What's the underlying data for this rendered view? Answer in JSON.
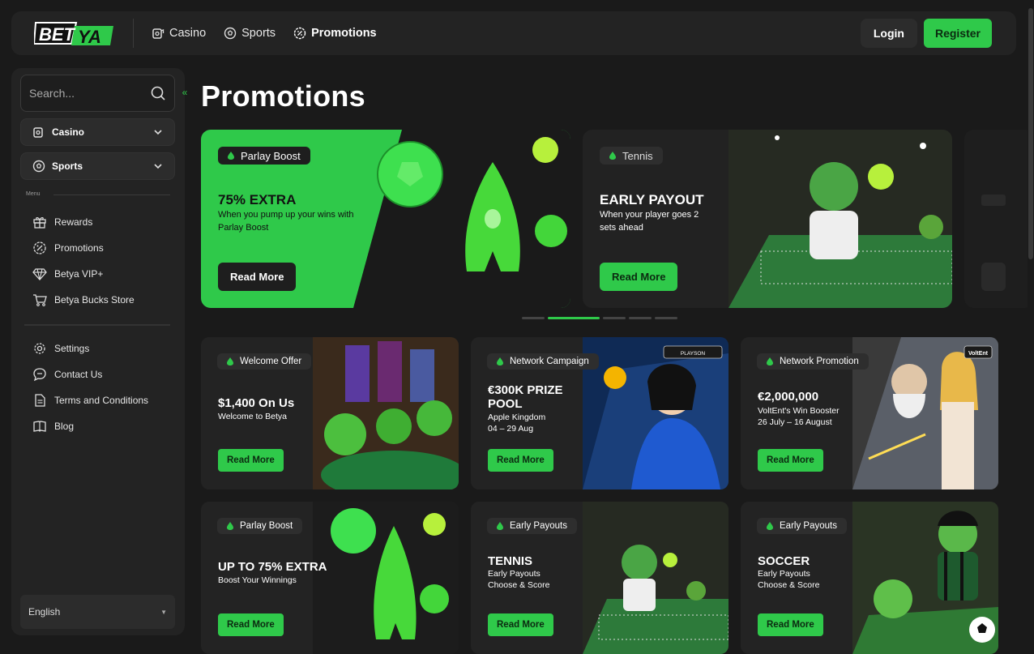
{
  "header": {
    "logo_text": "BETYA",
    "nav": [
      {
        "label": "Casino",
        "icon": "casino-icon"
      },
      {
        "label": "Sports",
        "icon": "soccer-ball-icon"
      },
      {
        "label": "Promotions",
        "icon": "promotions-icon"
      }
    ],
    "login_label": "Login",
    "register_label": "Register"
  },
  "sidebar": {
    "search_placeholder": "Search...",
    "dropdowns": [
      {
        "label": "Casino",
        "icon": "casino-icon"
      },
      {
        "label": "Sports",
        "icon": "soccer-ball-icon"
      }
    ],
    "menu_label": "Menu",
    "items": [
      {
        "label": "Rewards",
        "icon": "gift-icon"
      },
      {
        "label": "Promotions",
        "icon": "promotions-icon"
      },
      {
        "label": "Betya VIP+",
        "icon": "diamond-icon"
      },
      {
        "label": "Betya Bucks Store",
        "icon": "cart-icon"
      }
    ],
    "items2": [
      {
        "label": "Settings",
        "icon": "gear-icon"
      },
      {
        "label": "Contact Us",
        "icon": "chat-icon"
      },
      {
        "label": "Terms and Conditions",
        "icon": "document-icon"
      },
      {
        "label": "Blog",
        "icon": "book-icon"
      }
    ],
    "language": "English"
  },
  "main": {
    "title": "Promotions",
    "hero": [
      {
        "tag": "Parlay Boost",
        "title": "75% EXTRA",
        "desc": "When you pump up your wins with Parlay Boost",
        "button": "Read More"
      },
      {
        "tag": "Tennis",
        "title": "EARLY PAYOUT",
        "desc": "When your player goes 2 sets ahead",
        "button": "Read More"
      }
    ],
    "carousel_active_index": 1,
    "carousel_count": 5,
    "cards": [
      {
        "tag": "Welcome Offer",
        "title": "$1,400 On Us",
        "desc": "Welcome to Betya",
        "button": "Read More"
      },
      {
        "tag": "Network Campaign",
        "title": "€300K PRIZE POOL",
        "desc": "Apple Kingdom\n04 – 29 Aug",
        "button": "Read More",
        "badge": "PLAYSON"
      },
      {
        "tag": "Network Promotion",
        "title": "€2,000,000",
        "desc": "VoltEnt's Win Booster\n26 July – 16 August",
        "button": "Read More",
        "badge": "VoltEnt"
      },
      {
        "tag": "Parlay Boost",
        "title": "UP TO 75% EXTRA",
        "desc": "Boost Your Winnings",
        "button": "Read More"
      },
      {
        "tag": "Early Payouts",
        "title": "TENNIS",
        "desc": "Early Payouts\nChoose & Score",
        "button": "Read More"
      },
      {
        "tag": "Early Payouts",
        "title": "SOCCER",
        "desc": "Early Payouts\nChoose & Score",
        "button": "Read More"
      }
    ]
  },
  "colors": {
    "accent": "#2fc94a",
    "background": "#1a1a1a",
    "panel": "#232323"
  }
}
